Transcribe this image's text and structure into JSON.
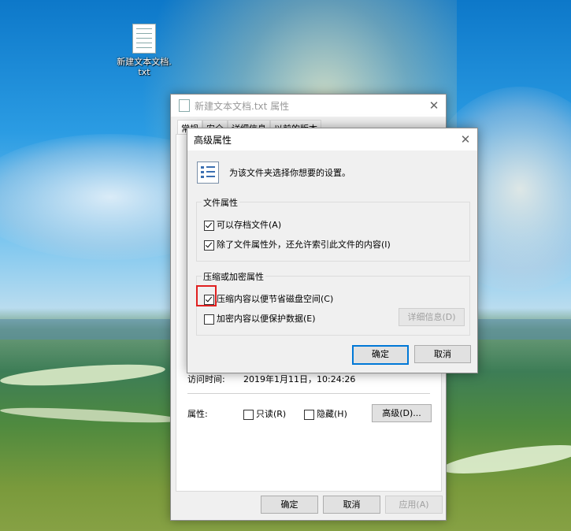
{
  "desktop": {
    "file_icon_label": "新建文本文档.txt"
  },
  "properties_window": {
    "title": "新建文本文档.txt 属性",
    "close_glyph": "✕",
    "tabs": [
      "常规",
      "安全",
      "详细信息",
      "以前的版本"
    ],
    "access_time_label": "访问时间:",
    "access_time_value": "2019年1月11日，10:24:26",
    "attributes_label": "属性:",
    "readonly_label": "只读(R)",
    "hidden_label": "隐藏(H)",
    "advanced_button": "高级(D)...",
    "ok_button": "确定",
    "cancel_button": "取消",
    "apply_button": "应用(A)"
  },
  "advanced_dialog": {
    "title": "高级属性",
    "close_glyph": "✕",
    "description": "为该文件夹选择你想要的设置。",
    "file_attributes_group": "文件属性",
    "archive_option": "可以存档文件(A)",
    "archive_checked": true,
    "index_option": "除了文件属性外，还允许索引此文件的内容(I)",
    "index_checked": true,
    "compress_group": "压缩或加密属性",
    "compress_option": "压缩内容以便节省磁盘空间(C)",
    "compress_checked": true,
    "encrypt_option": "加密内容以便保护数据(E)",
    "encrypt_checked": false,
    "details_button": "详细信息(D)",
    "ok_button": "确定",
    "cancel_button": "取消"
  }
}
